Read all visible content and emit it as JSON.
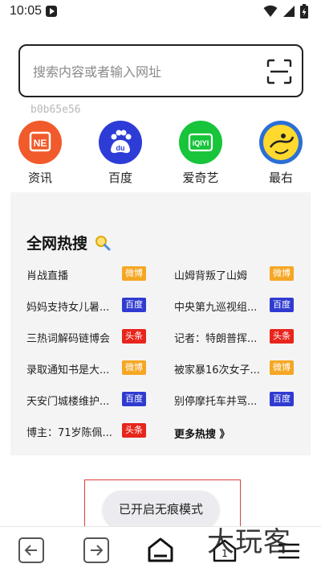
{
  "status_bar": {
    "time": "10:05"
  },
  "search": {
    "placeholder": "搜索内容或者输入网址"
  },
  "device_id": "b0b65e56",
  "shortcuts": [
    {
      "label": "资讯",
      "icon": "news-icon",
      "color": "#f15a2b"
    },
    {
      "label": "百度",
      "icon": "baidu-icon",
      "color": "#2d3cd6"
    },
    {
      "label": "爱奇艺",
      "icon": "iqiyi-icon",
      "color": "#17c43a"
    },
    {
      "label": "最右",
      "icon": "zuiyou-icon",
      "color": "#2b6fd6"
    }
  ],
  "hot": {
    "title": "全网热搜",
    "items": [
      {
        "text": "肖战直播",
        "tag": "微博",
        "tag_color": "#f5a623"
      },
      {
        "text": "山姆背叛了山姆",
        "tag": "微博",
        "tag_color": "#f5a623"
      },
      {
        "text": "妈妈支持女儿暑...",
        "tag": "百度",
        "tag_color": "#2f3bd0"
      },
      {
        "text": "中央第九巡视组...",
        "tag": "百度",
        "tag_color": "#2f3bd0"
      },
      {
        "text": "三热词解码链博会",
        "tag": "头条",
        "tag_color": "#e8251c"
      },
      {
        "text": "记者：特朗普挥...",
        "tag": "头条",
        "tag_color": "#e8251c"
      },
      {
        "text": "录取通知书是大...",
        "tag": "微博",
        "tag_color": "#f5a623"
      },
      {
        "text": "被家暴16次女子...",
        "tag": "微博",
        "tag_color": "#f5a623"
      },
      {
        "text": "天安门城楼维护...",
        "tag": "百度",
        "tag_color": "#2f3bd0"
      },
      {
        "text": "别停摩托车并骂...",
        "tag": "百度",
        "tag_color": "#2f3bd0"
      },
      {
        "text": "博主：71岁陈佩...",
        "tag": "头条",
        "tag_color": "#e8251c"
      }
    ],
    "more_label": "更多热搜 》"
  },
  "toast": {
    "text": "已开启无痕模式"
  },
  "nav": {
    "tab_count": "1"
  },
  "watermark": "大玩客"
}
